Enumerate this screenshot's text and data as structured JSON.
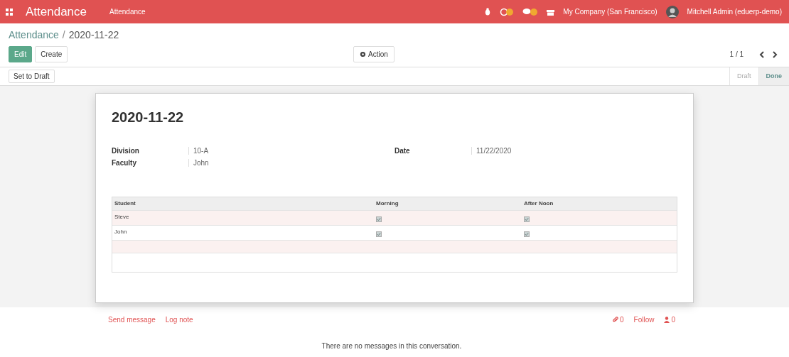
{
  "navbar": {
    "app_title": "Attendance",
    "menu": [
      {
        "label": "Attendance"
      }
    ],
    "company": "My Company (San Francisco)",
    "user": "Mitchell Admin (eduerp-demo)"
  },
  "breadcrumb": {
    "parent": "Attendance",
    "separator": "/",
    "current": "2020-11-22"
  },
  "buttons": {
    "edit": "Edit",
    "create": "Create",
    "action": "Action"
  },
  "pager": "1 / 1",
  "status_button": "Set to Draft",
  "stages": [
    {
      "label": "Draft",
      "selected": false
    },
    {
      "label": "Done",
      "selected": true
    }
  ],
  "sheet": {
    "title": "2020-11-22",
    "left_fields": [
      {
        "label": "Division",
        "value": "10-A"
      },
      {
        "label": "Faculty",
        "value": "John"
      }
    ],
    "right_fields": [
      {
        "label": "Date",
        "value": "11/22/2020"
      }
    ],
    "table": {
      "columns": [
        "Student",
        "Morning",
        "After Noon"
      ],
      "rows": [
        {
          "student": "Steve",
          "morning": true,
          "afternoon": true
        },
        {
          "student": "John",
          "morning": true,
          "afternoon": true
        }
      ]
    }
  },
  "chatter": {
    "send_message": "Send message",
    "log_note": "Log note",
    "attachments": "0",
    "follow": "Follow",
    "followers": "0",
    "empty": "There are no messages in this conversation."
  }
}
